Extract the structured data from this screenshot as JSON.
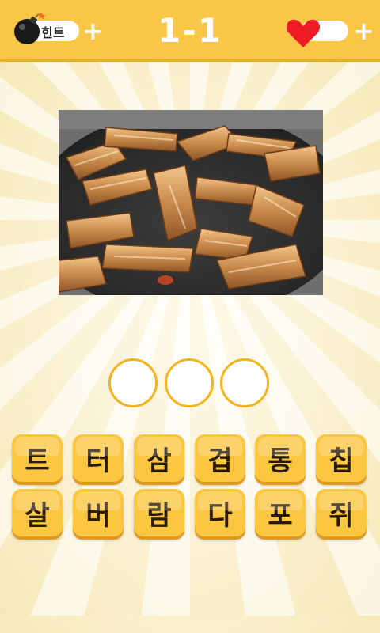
{
  "header": {
    "level": "1-1",
    "hint_label": "힌트",
    "hint_plus": "+",
    "life_plus": "+"
  },
  "icons": {
    "hint": "bomb-icon",
    "life": "heart-icon"
  },
  "colors": {
    "header_bg": "#f9c646",
    "tile_bg": "#fbc640",
    "slot_border": "#f5b31c",
    "heart": "#ee1c24"
  },
  "answer_slots": [
    "",
    "",
    ""
  ],
  "tiles": [
    "트",
    "터",
    "삼",
    "겹",
    "통",
    "칩",
    "살",
    "버",
    "람",
    "다",
    "포",
    "쥐"
  ]
}
